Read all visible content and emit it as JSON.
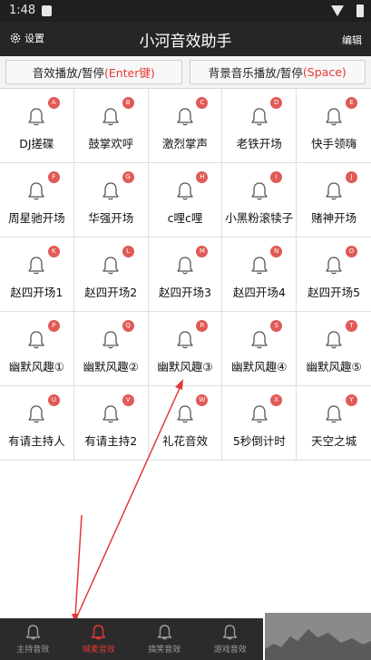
{
  "status": {
    "time": "1:48"
  },
  "header": {
    "settings_label": "设置",
    "title": "小河音效助手",
    "edit_label": "编辑"
  },
  "controls": {
    "sfx_toggle_text": "音效播放/暂停",
    "sfx_toggle_key": "(Enter键)",
    "bgm_toggle_text": "背景音乐播放/暂停",
    "bgm_toggle_key": "(Space)"
  },
  "sounds": [
    {
      "key": "A",
      "label": "DJ搓碟"
    },
    {
      "key": "B",
      "label": "鼓掌欢呼"
    },
    {
      "key": "C",
      "label": "激烈掌声"
    },
    {
      "key": "D",
      "label": "老铁开场"
    },
    {
      "key": "E",
      "label": "快手领嗨"
    },
    {
      "key": "F",
      "label": "周星驰开场"
    },
    {
      "key": "G",
      "label": "华强开场"
    },
    {
      "key": "H",
      "label": "c哩c哩"
    },
    {
      "key": "I",
      "label": "小黑粉滚犊子"
    },
    {
      "key": "J",
      "label": "赌神开场"
    },
    {
      "key": "K",
      "label": "赵四开场1"
    },
    {
      "key": "L",
      "label": "赵四开场2"
    },
    {
      "key": "M",
      "label": "赵四开场3"
    },
    {
      "key": "N",
      "label": "赵四开场4"
    },
    {
      "key": "O",
      "label": "赵四开场5"
    },
    {
      "key": "P",
      "label": "幽默风趣①"
    },
    {
      "key": "Q",
      "label": "幽默风趣②"
    },
    {
      "key": "R",
      "label": "幽默风趣③"
    },
    {
      "key": "S",
      "label": "幽默风趣④"
    },
    {
      "key": "T",
      "label": "幽默风趣⑤"
    },
    {
      "key": "U",
      "label": "有请主持人"
    },
    {
      "key": "V",
      "label": "有请主持2"
    },
    {
      "key": "W",
      "label": "礼花音效"
    },
    {
      "key": "X",
      "label": "5秒倒计时"
    },
    {
      "key": "Y",
      "label": "天空之城"
    }
  ],
  "nav": {
    "active_index": 1,
    "tabs": [
      {
        "label": "主持音效"
      },
      {
        "label": "喊麦音效"
      },
      {
        "label": "搞笑音效"
      },
      {
        "label": "游戏音效"
      }
    ]
  },
  "colors": {
    "accent": "#e53935",
    "badge": "#e05a56",
    "header_bg": "#262626"
  }
}
